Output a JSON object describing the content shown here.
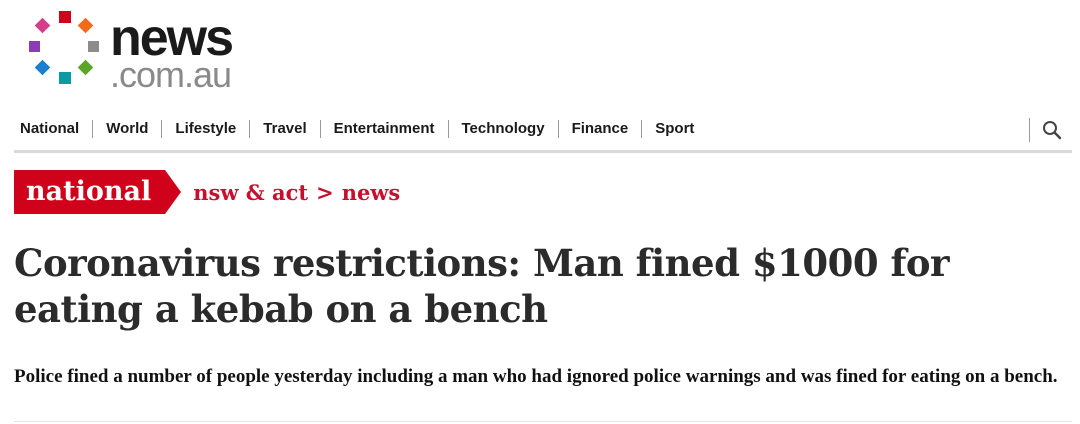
{
  "logo": {
    "word": "news",
    "domain": ".com.au",
    "dot_colors": [
      "#d0021b",
      "#f26b1d",
      "#8c8c8c",
      "#5ba42a",
      "#0a9aa3",
      "#1a7fd1",
      "#8e3ab5",
      "#d63d8c"
    ]
  },
  "nav": {
    "items": [
      {
        "label": "National"
      },
      {
        "label": "World"
      },
      {
        "label": "Lifestyle"
      },
      {
        "label": "Travel"
      },
      {
        "label": "Entertainment"
      },
      {
        "label": "Technology"
      },
      {
        "label": "Finance"
      },
      {
        "label": "Sport"
      }
    ],
    "search_icon": "search-icon"
  },
  "section": {
    "tag": "national",
    "crumbs": [
      {
        "label": "nsw & act"
      },
      {
        "label": "news"
      }
    ],
    "separator": ">",
    "accent_color": "#d0021b"
  },
  "article": {
    "headline": "Coronavirus restrictions: Man fined $1000 for eating a kebab on a bench",
    "standfirst": "Police fined a number of people yesterday including a man who had ignored police warnings and was fined for eating on a bench."
  }
}
